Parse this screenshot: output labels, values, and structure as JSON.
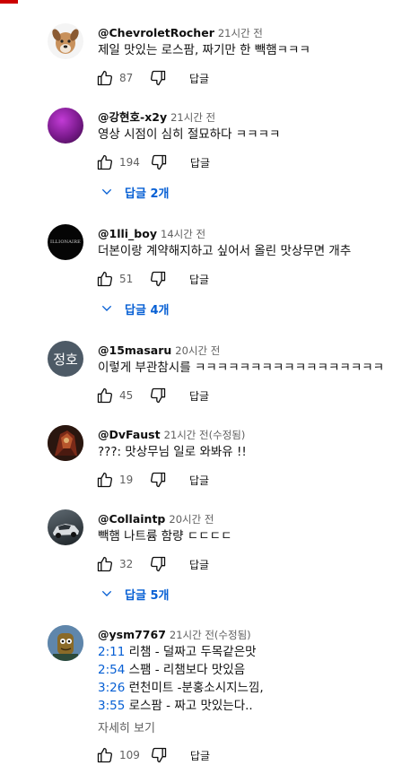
{
  "ui": {
    "reply": "답글",
    "more": "자세히 보기"
  },
  "comments": [
    {
      "author": "@ChevroletRocher",
      "time": "21시간 전",
      "text": "제일 맛있는 로스팜, 짜기만 한 빽햄ㅋㅋㅋ",
      "likes": "87",
      "avatar_icon": "dog-icon"
    },
    {
      "author": "@강현호-x2y",
      "time": "21시간 전",
      "text": "영상 시점이 심히 절묘하다 ㅋㅋㅋㅋ",
      "likes": "194",
      "replies": "답글 2개",
      "avatar_icon": "purple-orb-icon"
    },
    {
      "author": "@1lli_boy",
      "time": "14시간 전",
      "text": "더본이랑 계약해지하고 싶어서 올린 맛상무면 개추",
      "likes": "51",
      "replies": "답글 4개",
      "avatar_text": "ILLIONAIRE"
    },
    {
      "author": "@15masaru",
      "time": "20시간 전",
      "text": "이렇게 부관참시를 ㅋㅋㅋㅋㅋㅋㅋㅋㅋㅋㅋㅋㅋㅋㅋㅋㅋ",
      "likes": "45",
      "avatar_text": "정호"
    },
    {
      "author": "@DvFaust",
      "time": "21시간 전(수정됨)",
      "text": "???: 맛상무님  일로 와봐유 !!",
      "likes": "19",
      "avatar_icon": "armored-warrior-icon"
    },
    {
      "author": "@Collaintp",
      "time": "20시간 전",
      "text": "빽햄 나트륨 함량 ㄷㄷㄷㄷ",
      "likes": "32",
      "replies": "답글 5개",
      "avatar_icon": "car-icon"
    },
    {
      "author": "@ysm7767",
      "time": "21시간 전(수정됨)",
      "likes": "109",
      "avatar_icon": "cartoon-character-icon",
      "lines": [
        {
          "ts": "2:11",
          "text": " 리챔 - 덜짜고 두목같은맛"
        },
        {
          "ts": "2:54",
          "text": " 스팸 - 리챔보다 맛있음"
        },
        {
          "ts": "3:26",
          "text": " 런천미트 -분홍소시지느낌,"
        },
        {
          "ts": "3:55",
          "text": " 로스팜 - 짜고 맛있는다.."
        }
      ]
    }
  ],
  "colors": {
    "link": "#065fd4",
    "secondary_text": "#606060",
    "avatar_gray": "#4d5a66"
  }
}
